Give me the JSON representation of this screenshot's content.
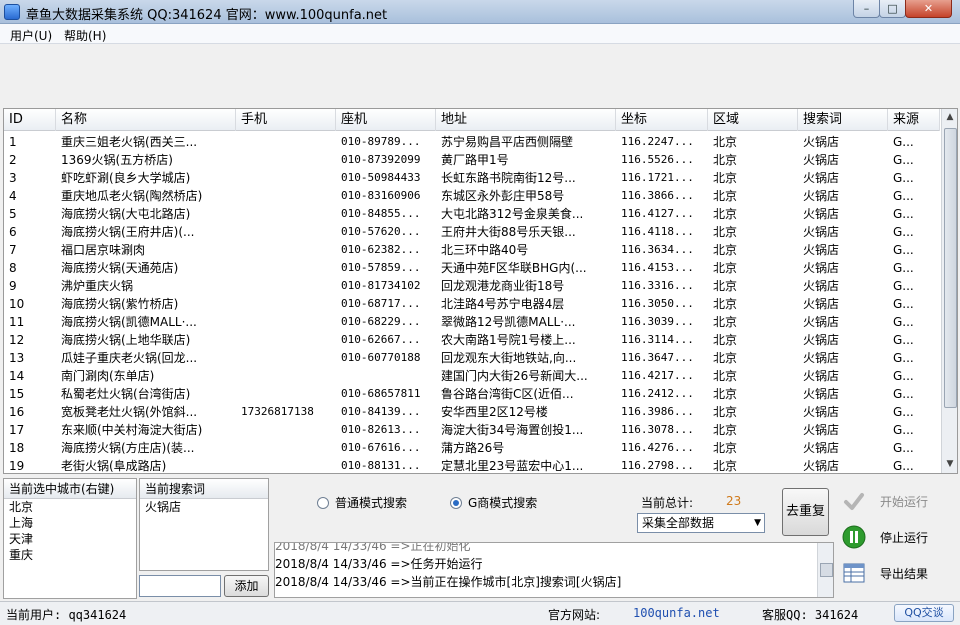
{
  "window": {
    "title": "章鱼大数据采集系统 QQ:341624 官网：www.100qunfa.net",
    "min": "–",
    "max": "□",
    "close": "✕"
  },
  "menu": {
    "user": "用户(U)",
    "help": "帮助(H)"
  },
  "table": {
    "columns": [
      "ID",
      "名称",
      "手机",
      "座机",
      "地址",
      "坐标",
      "区域",
      "搜索词",
      "来源"
    ],
    "rows": [
      [
        "1",
        "重庆三姐老火锅(西关三...",
        "",
        "010-89789...",
        "苏宁易购昌平店西侧隔壁",
        "116.2247...",
        "北京",
        "火锅店",
        "G..."
      ],
      [
        "2",
        "1369火锅(五方桥店)",
        "",
        "010-87392099",
        "黄厂路甲1号",
        "116.5526...",
        "北京",
        "火锅店",
        "G..."
      ],
      [
        "3",
        "虾吃虾涮(良乡大学城店)",
        "",
        "010-50984433",
        "长虹东路书院南街12号...",
        "116.1721...",
        "北京",
        "火锅店",
        "G..."
      ],
      [
        "4",
        "重庆地瓜老火锅(陶然桥店)",
        "",
        "010-83160906",
        "东城区永外彭庄甲58号",
        "116.3866...",
        "北京",
        "火锅店",
        "G..."
      ],
      [
        "5",
        "海底捞火锅(大屯北路店)",
        "",
        "010-84855...",
        "大屯北路312号金泉美食...",
        "116.4127...",
        "北京",
        "火锅店",
        "G..."
      ],
      [
        "6",
        "海底捞火锅(王府井店)(...",
        "",
        "010-57620...",
        "王府井大街88号乐天银...",
        "116.4118...",
        "北京",
        "火锅店",
        "G..."
      ],
      [
        "7",
        "福口居京味涮肉",
        "",
        "010-62382...",
        "北三环中路40号",
        "116.3634...",
        "北京",
        "火锅店",
        "G..."
      ],
      [
        "8",
        "海底捞火锅(天通苑店)",
        "",
        "010-57859...",
        "天通中苑F区华联BHG内(...",
        "116.4153...",
        "北京",
        "火锅店",
        "G..."
      ],
      [
        "9",
        "沸炉重庆火锅",
        "",
        "010-81734102",
        "回龙观港龙商业街18号",
        "116.3316...",
        "北京",
        "火锅店",
        "G..."
      ],
      [
        "10",
        "海底捞火锅(紫竹桥店)",
        "",
        "010-68717...",
        "北洼路4号苏宁电器4层",
        "116.3050...",
        "北京",
        "火锅店",
        "G..."
      ],
      [
        "11",
        "海底捞火锅(凯德MALL·...",
        "",
        "010-68229...",
        "翠微路12号凯德MALL·...",
        "116.3039...",
        "北京",
        "火锅店",
        "G..."
      ],
      [
        "12",
        "海底捞火锅(上地华联店)",
        "",
        "010-62667...",
        "农大南路1号院1号楼上...",
        "116.3114...",
        "北京",
        "火锅店",
        "G..."
      ],
      [
        "13",
        "瓜娃子重庆老火锅(回龙...",
        "",
        "010-60770188",
        "回龙观东大街地铁站,向...",
        "116.3647...",
        "北京",
        "火锅店",
        "G..."
      ],
      [
        "14",
        "南门涮肉(东单店)",
        "",
        "",
        "建国门内大街26号新闻大...",
        "116.4217...",
        "北京",
        "火锅店",
        "G..."
      ],
      [
        "15",
        "私蜀老灶火锅(台湾街店)",
        "",
        "010-68657811",
        "鲁谷路台湾街C区(近佰...",
        "116.2412...",
        "北京",
        "火锅店",
        "G..."
      ],
      [
        "16",
        "宽板凳老灶火锅(外馆斜...",
        "17326817138",
        "010-84139...",
        "安华西里2区12号楼",
        "116.3986...",
        "北京",
        "火锅店",
        "G..."
      ],
      [
        "17",
        "东来顺(中关村海淀大街店)",
        "",
        "010-82613...",
        "海淀大街34号海置创投1...",
        "116.3078...",
        "北京",
        "火锅店",
        "G..."
      ],
      [
        "18",
        "海底捞火锅(方庄店)(装...",
        "",
        "010-67616...",
        "蒲方路26号",
        "116.4276...",
        "北京",
        "火锅店",
        "G..."
      ],
      [
        "19",
        "老街火锅(阜成路店)",
        "",
        "010-88131...",
        "定慧北里23号蓝宏中心1...",
        "116.2798...",
        "北京",
        "火锅店",
        "G..."
      ]
    ]
  },
  "cities": {
    "header": "当前选中城市(右键)",
    "items": [
      "北京",
      "上海",
      "天津",
      "重庆"
    ]
  },
  "keywords": {
    "header": "当前搜索词",
    "items": [
      "火锅店"
    ],
    "add_label": "添加"
  },
  "controls": {
    "radio_normal": "普通模式搜索",
    "radio_g": "G商模式搜索",
    "selected_mode": "g",
    "total_label": "当前总计:",
    "total_value": "23",
    "select_value": "采集全部数据",
    "dedup_label": "去重复"
  },
  "log": [
    "2018/8/4 14/33/46 =>任务开始运行",
    "2018/8/4 14/33/46 =>当前正在操作城市[北京]搜索词[火锅店]"
  ],
  "actions": {
    "start": "开始运行",
    "stop": "停止运行",
    "export": "导出结果"
  },
  "status": {
    "user": "当前用户: qq341624",
    "site_label": "官方网站:",
    "site_url": "100qunfa.net",
    "qq_label": "客服QQ: 341624",
    "chat_label": "QQ交谈"
  }
}
